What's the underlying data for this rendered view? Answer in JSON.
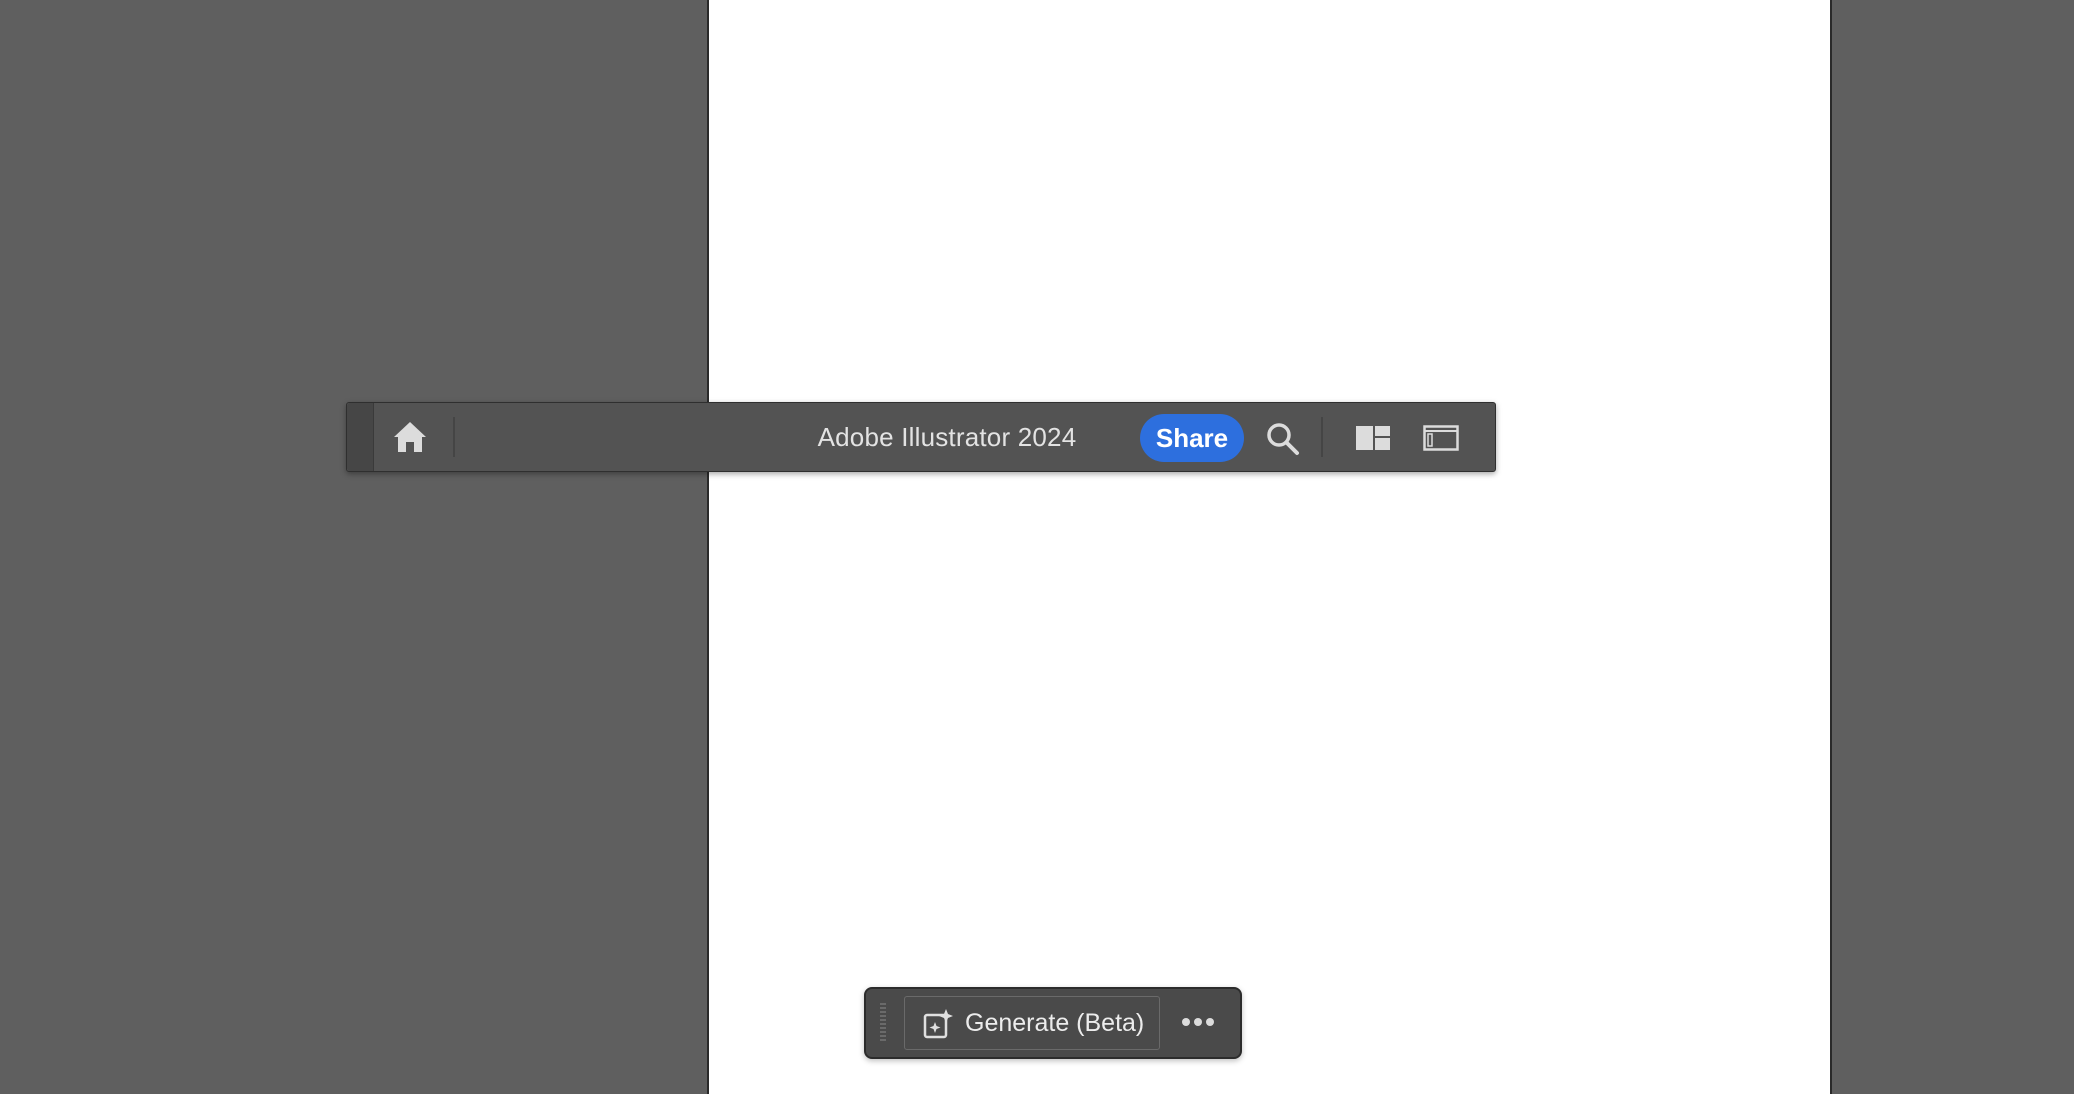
{
  "app_bar": {
    "title": "Adobe Illustrator 2024",
    "share_label": "Share",
    "icons": [
      "home-icon",
      "search-icon",
      "workspace-layout-icon",
      "panel-toggle-icon"
    ],
    "accent_color": "#2d6fde"
  },
  "task_bar": {
    "generate_label": "Generate (Beta)",
    "icons": [
      "generate-sparkle-icon",
      "more-options-icon"
    ]
  },
  "colors": {
    "canvas_background": "#5f5f5f",
    "artboard": "#ffffff",
    "toolbar": "#535353"
  }
}
